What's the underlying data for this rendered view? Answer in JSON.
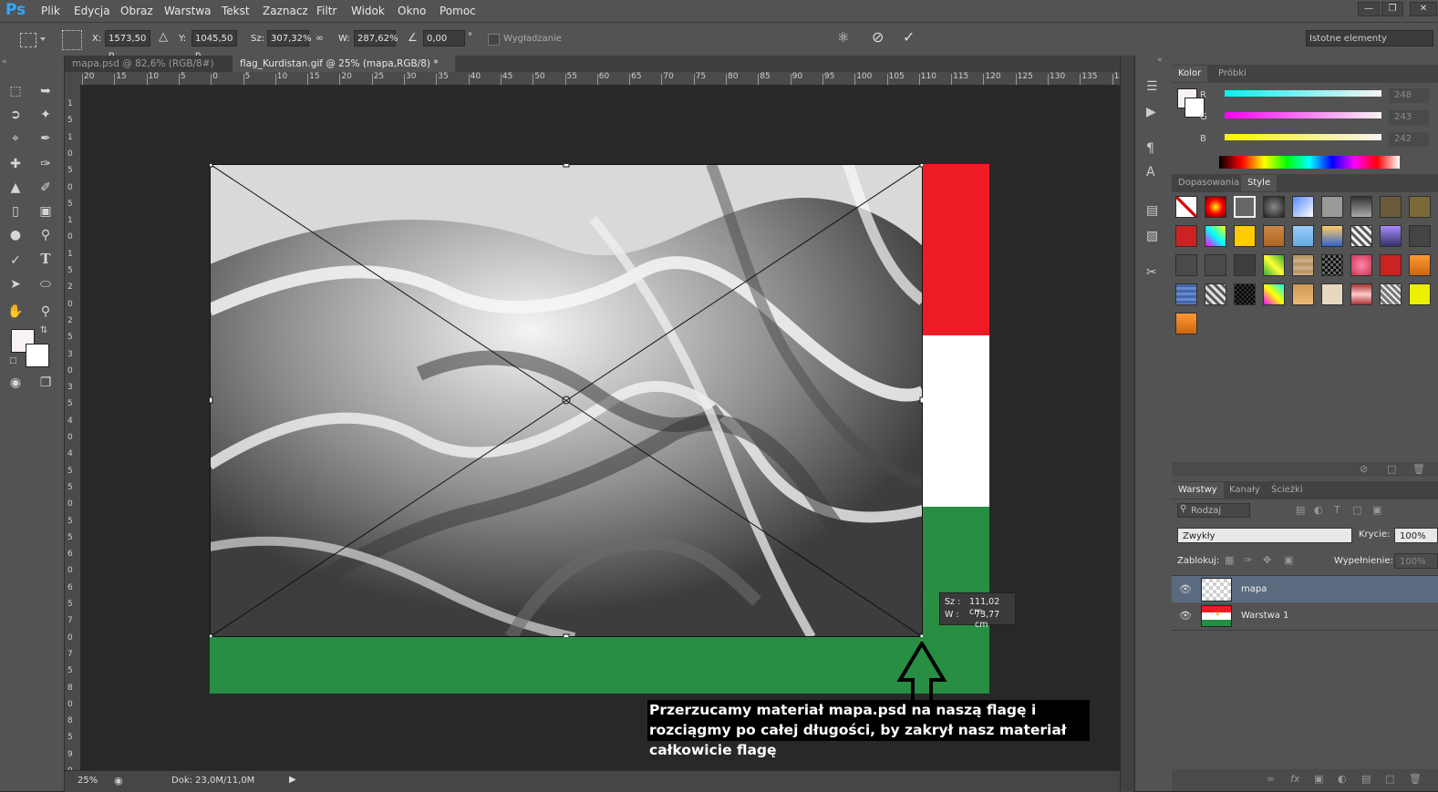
{
  "app": {
    "logo": "Ps"
  },
  "menu": [
    "Plik",
    "Edycja",
    "Obraz",
    "Warstwa",
    "Tekst",
    "Zaznacz",
    "Filtr",
    "Widok",
    "Okno",
    "Pomoc"
  ],
  "window_controls": [
    "minimize-icon",
    "restore-icon",
    "close-icon"
  ],
  "options_bar": {
    "x_label": "X:",
    "x_value": "1573,50 p",
    "y_label": "Y:",
    "y_value": "1045,50 p",
    "w_label": "Sz:",
    "w_value": "307,32%",
    "h_label": "W:",
    "h_value": "287,62%",
    "angle_value": "0,00",
    "angle_unit": "°",
    "antialias_label": "Wygładzanie",
    "workspace": "Istotne elementy"
  },
  "doc_tabs": [
    {
      "label": "mapa.psd @ 82,6% (RGB/8#)",
      "close": "×",
      "active": false
    },
    {
      "label": "flag_Kurdistan.gif @ 25% (mapa,RGB/8) *",
      "close": "×",
      "active": true
    }
  ],
  "ruler_top": [
    "20",
    "15",
    "10",
    "5",
    "0",
    "5",
    "10",
    "15",
    "20",
    "25",
    "30",
    "35",
    "40",
    "45",
    "50",
    "55",
    "60",
    "65",
    "70",
    "75",
    "80",
    "85",
    "90",
    "95",
    "100",
    "105",
    "110",
    "115",
    "120",
    "125",
    "130",
    "135",
    "14"
  ],
  "ruler_left": [
    "1",
    "5",
    "1",
    "0",
    "5",
    "0",
    "5",
    "1",
    "0",
    "1",
    "5",
    "2",
    "0",
    "2",
    "5",
    "3",
    "0",
    "3",
    "5",
    "4",
    "0",
    "4",
    "5",
    "5",
    "0",
    "5",
    "5",
    "6",
    "0",
    "6",
    "5",
    "7",
    "0",
    "7",
    "5",
    "8",
    "0",
    "8",
    "5",
    "9",
    "0"
  ],
  "transform_tooltip": {
    "w_label": "Sz :",
    "w_value": "111,02 cm",
    "h_label": "W :",
    "h_value": "73,77 cm"
  },
  "annotation": "Przerzucamy materiał mapa.psd na naszą flagę i rozciągmy po całej długości, by zakrył nasz materiał całkowicie flagę",
  "status": {
    "zoom": "25%",
    "doc": "Dok: 23,0M/11,0M"
  },
  "flag_colors": {
    "red": "#ED1C24",
    "white": "#FFFFFF",
    "green": "#278E43"
  },
  "color_panel": {
    "tabs": [
      "Kolor",
      "Próbki"
    ],
    "r_label": "R",
    "r_value": "248",
    "g_label": "G",
    "g_value": "243",
    "b_label": "B",
    "b_value": "242"
  },
  "styles_panel": {
    "tabs": [
      "Dopasowania",
      "Style"
    ]
  },
  "layers_panel": {
    "tabs": [
      "Warstwy",
      "Kanały",
      "Ścieżki"
    ],
    "kind_label": "Rodzaj",
    "blend_mode": "Zwykły",
    "opacity_label": "Krycie:",
    "opacity_value": "100%",
    "lock_label": "Zablokuj:",
    "fill_label": "Wypełnienie:",
    "fill_value": "100%",
    "layers": [
      {
        "name": "mapa",
        "selected": true
      },
      {
        "name": "Warstwa 1",
        "selected": false
      }
    ]
  }
}
